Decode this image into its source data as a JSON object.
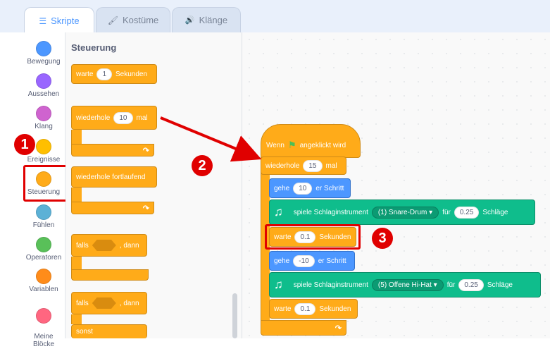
{
  "tabs": [
    {
      "label": "Skripte",
      "icon": "code-icon",
      "active": true
    },
    {
      "label": "Kostüme",
      "icon": "brush-icon",
      "active": false
    },
    {
      "label": "Klänge",
      "icon": "speaker-icon",
      "active": false
    }
  ],
  "categories": [
    {
      "label": "Bewegung",
      "color": "#4c97ff"
    },
    {
      "label": "Aussehen",
      "color": "#9966ff"
    },
    {
      "label": "Klang",
      "color": "#cf63cf"
    },
    {
      "label": "Ereignisse",
      "color": "#ffbf00"
    },
    {
      "label": "Steuerung",
      "color": "#ffab19"
    },
    {
      "label": "Fühlen",
      "color": "#5cb1d6"
    },
    {
      "label": "Operatoren",
      "color": "#59c059"
    },
    {
      "label": "Variablen",
      "color": "#ff8c1a"
    },
    {
      "label": "Meine\nBlöcke",
      "color": "#ff6680"
    }
  ],
  "palette": {
    "title": "Steuerung",
    "wait": {
      "pre": "warte",
      "value": "1",
      "post": "Sekunden"
    },
    "repeat": {
      "pre": "wiederhole",
      "value": "10",
      "post": "mal"
    },
    "forever": {
      "label": "wiederhole fortlaufend"
    },
    "if_then": {
      "pre": "falls",
      "post": ", dann"
    },
    "if_else": {
      "pre": "falls",
      "post": ", dann",
      "else": "sonst"
    }
  },
  "script": {
    "hat": {
      "pre": "Wenn",
      "post": "angeklickt wird"
    },
    "repeat": {
      "pre": "wiederhole",
      "value": "15",
      "post": "mal"
    },
    "move1": {
      "pre": "gehe",
      "value": "10",
      "post": "er Schritt"
    },
    "drum1": {
      "label": "spiele Schlaginstrument",
      "drum": "(1) Snare-Drum",
      "pre": "für",
      "value": "0.25",
      "post": "Schläge"
    },
    "wait1": {
      "pre": "warte",
      "value": "0.1",
      "post": "Sekunden"
    },
    "move2": {
      "pre": "gehe",
      "value": "-10",
      "post": "er Schritt"
    },
    "drum2": {
      "label": "spiele Schlaginstrument",
      "drum": "(5) Offene Hi-Hat",
      "pre": "für",
      "value": "0.25",
      "post": "Schläge"
    },
    "wait2": {
      "pre": "warte",
      "value": "0.1",
      "post": "Sekunden"
    }
  },
  "annotations": {
    "one": "1",
    "two": "2",
    "three": "3"
  },
  "colors": {
    "control": "#ffab19",
    "motion": "#4c97ff",
    "extension": "#0fbd8c",
    "highlight": "#e00000"
  }
}
